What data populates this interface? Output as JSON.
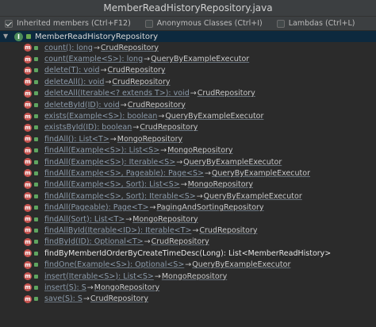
{
  "window": {
    "title": "MemberReadHistoryRepository.java"
  },
  "toolbar": {
    "options": [
      {
        "label": "Inherited members (Ctrl+F12)",
        "checked": true
      },
      {
        "label": "Anonymous Classes (Ctrl+I)",
        "checked": false
      },
      {
        "label": "Lambdas (Ctrl+L)",
        "checked": false
      }
    ]
  },
  "tree": {
    "root": {
      "label": "MemberReadHistoryRepository",
      "icon": "interface-icon"
    },
    "members": [
      {
        "signature": "count(): long",
        "owner": "CrudRepository",
        "inherited": true
      },
      {
        "signature": "count(Example<S>): long",
        "owner": "QueryByExampleExecutor",
        "inherited": true
      },
      {
        "signature": "delete(T): void",
        "owner": "CrudRepository",
        "inherited": true
      },
      {
        "signature": "deleteAll(): void",
        "owner": "CrudRepository",
        "inherited": true
      },
      {
        "signature": "deleteAll(Iterable<? extends T>): void",
        "owner": "CrudRepository",
        "inherited": true
      },
      {
        "signature": "deleteById(ID): void",
        "owner": "CrudRepository",
        "inherited": true
      },
      {
        "signature": "exists(Example<S>): boolean",
        "owner": "QueryByExampleExecutor",
        "inherited": true
      },
      {
        "signature": "existsById(ID): boolean",
        "owner": "CrudRepository",
        "inherited": true
      },
      {
        "signature": "findAll(): List<T>",
        "owner": "MongoRepository",
        "inherited": true
      },
      {
        "signature": "findAll(Example<S>): List<S>",
        "owner": "MongoRepository",
        "inherited": true
      },
      {
        "signature": "findAll(Example<S>): Iterable<S>",
        "owner": "QueryByExampleExecutor",
        "inherited": true
      },
      {
        "signature": "findAll(Example<S>, Pageable): Page<S>",
        "owner": "QueryByExampleExecutor",
        "inherited": true
      },
      {
        "signature": "findAll(Example<S>, Sort): List<S>",
        "owner": "MongoRepository",
        "inherited": true
      },
      {
        "signature": "findAll(Example<S>, Sort): Iterable<S>",
        "owner": "QueryByExampleExecutor",
        "inherited": true
      },
      {
        "signature": "findAll(Pageable): Page<T>",
        "owner": "PagingAndSortingRepository",
        "inherited": true
      },
      {
        "signature": "findAll(Sort): List<T>",
        "owner": "MongoRepository",
        "inherited": true
      },
      {
        "signature": "findAllById(Iterable<ID>): Iterable<T>",
        "owner": "CrudRepository",
        "inherited": true
      },
      {
        "signature": "findById(ID): Optional<T>",
        "owner": "CrudRepository",
        "inherited": true
      },
      {
        "signature": "findByMemberIdOrderByCreateTimeDesc(Long): List<MemberReadHistory>",
        "owner": "",
        "inherited": false
      },
      {
        "signature": "findOne(Example<S>): Optional<S>",
        "owner": "QueryByExampleExecutor",
        "inherited": true
      },
      {
        "signature": "insert(Iterable<S>): List<S>",
        "owner": "MongoRepository",
        "inherited": true
      },
      {
        "signature": "insert(S): S",
        "owner": "MongoRepository",
        "inherited": true
      },
      {
        "signature": "save(S): S",
        "owner": "CrudRepository",
        "inherited": true
      }
    ],
    "arrow_glyph": "→",
    "method_icon_letter": "m",
    "interface_icon_letter": "I"
  },
  "colors": {
    "background": "#2b2b2b",
    "selection": "#0d293e",
    "method_icon": "#c75450",
    "visibility_icon": "#5fa560"
  }
}
